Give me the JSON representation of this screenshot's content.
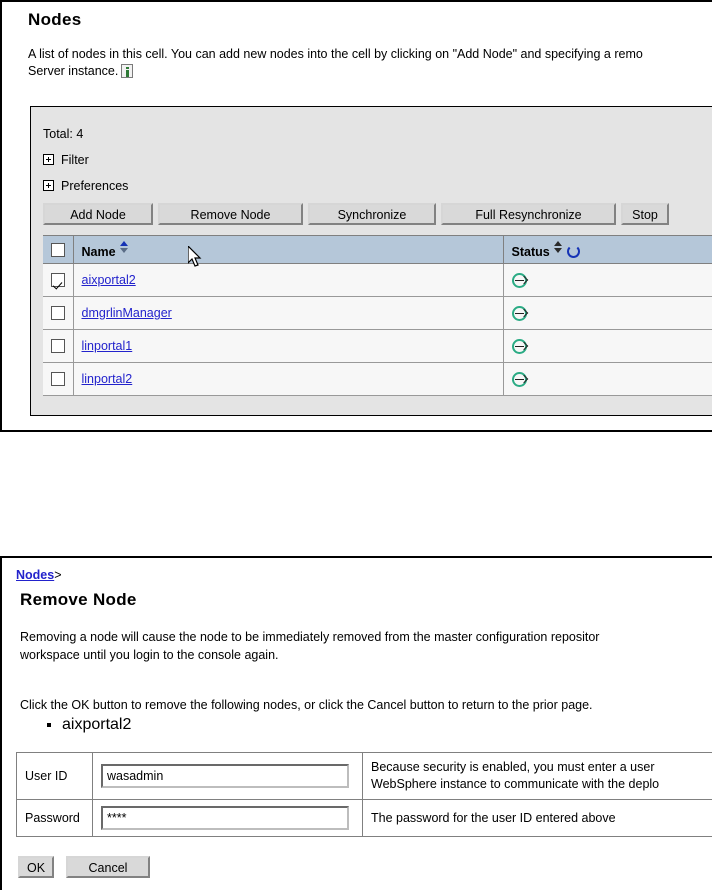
{
  "nodes_panel": {
    "title": "Nodes",
    "description_line1": "A list of nodes in this cell. You can add new nodes into the cell by clicking on \"Add Node\" and specifying a remo",
    "description_line2": "Server instance.",
    "info_icon": "info-icon",
    "collection": {
      "total_label": "Total: 4",
      "filter_label": "Filter",
      "preferences_label": "Preferences",
      "buttons": [
        {
          "label": "Add Node",
          "name": "add-node-button"
        },
        {
          "label": "Remove Node",
          "name": "remove-node-button"
        },
        {
          "label": "Synchronize",
          "name": "synchronize-button"
        },
        {
          "label": "Full Resynchronize",
          "name": "full-resynchronize-button"
        },
        {
          "label": "Stop",
          "name": "stop-button"
        }
      ],
      "columns": {
        "name": "Name",
        "status": "Status"
      },
      "rows": [
        {
          "name": "aixportal2",
          "checked": true,
          "status": "synchronized"
        },
        {
          "name": "dmgrlinManager",
          "checked": false,
          "status": "synchronized"
        },
        {
          "name": "linportal1",
          "checked": false,
          "status": "synchronized"
        },
        {
          "name": "linportal2",
          "checked": false,
          "status": "synchronized"
        }
      ]
    }
  },
  "remove_panel": {
    "breadcrumb_link": "Nodes",
    "breadcrumb_separator": ">",
    "title": "Remove Node",
    "description_line1": "Removing a node will cause the node to be immediately removed from the master configuration repositor",
    "description_line2": "workspace until you login to the console again.",
    "instruction": "Click the OK button to remove the following nodes, or click the Cancel button to return to the prior page.",
    "nodes": [
      "aixportal2"
    ],
    "form": {
      "userid_label": "User ID",
      "userid_value": "wasadmin",
      "userid_placeholder": "",
      "userid_help_line1": "Because security is enabled, you must enter a user",
      "userid_help_line2": "WebSphere instance to communicate with the deplo",
      "password_label": "Password",
      "password_value": "****",
      "password_placeholder": "",
      "password_help": "The password for the user ID entered above"
    },
    "ok_label": "OK",
    "cancel_label": "Cancel"
  },
  "colors": {
    "table_header_bg": "#b5c7d9",
    "panel_bg": "#e4e4e4",
    "link": "#2222cc",
    "status_green": "#2aab84",
    "sort_active": "#1633b5"
  }
}
